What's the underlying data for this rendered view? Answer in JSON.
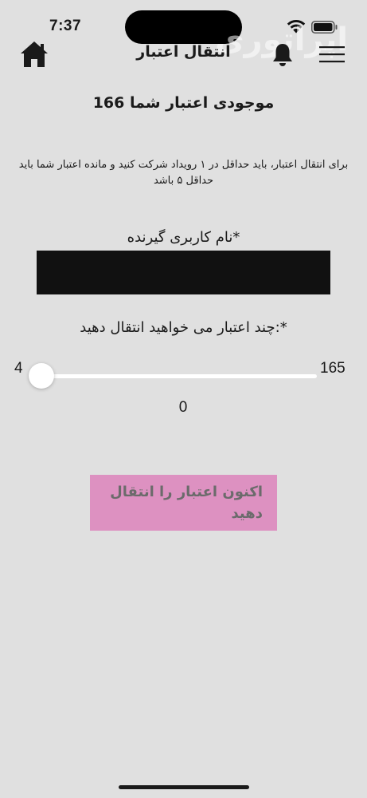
{
  "status_bar": {
    "time": "7:37",
    "wifi_icon": "wifi-icon",
    "battery_icon": "battery-icon"
  },
  "watermark": "اپراتوری",
  "header": {
    "title": "انتقال اعتبار",
    "home_icon": "home-icon",
    "bell_icon": "bell-icon",
    "menu_icon": "hamburger-menu-icon"
  },
  "balance_text": "موجودی اعتبار شما 166",
  "rule_text": "برای انتقال اعتبار، باید حداقل در ۱ رویداد شرکت کنید و مانده اعتبار شما باید حداقل ۵ باشد",
  "recipient": {
    "label": "نام کاربری گیرنده*",
    "value": "",
    "placeholder": ""
  },
  "amount": {
    "label": "چند اعتبار می خواهید انتقال دهید:*",
    "min_label": "4",
    "max_label": "165",
    "current_value": "0",
    "fill_fraction": 0
  },
  "submit": {
    "label": "اکنون اعتبار را انتقال دهید"
  },
  "colors": {
    "background": "#e0e0e0",
    "input_background": "#111111",
    "button_background": "#dd91c1",
    "button_text": "#6b6b6b",
    "slider": "#ffffff"
  }
}
